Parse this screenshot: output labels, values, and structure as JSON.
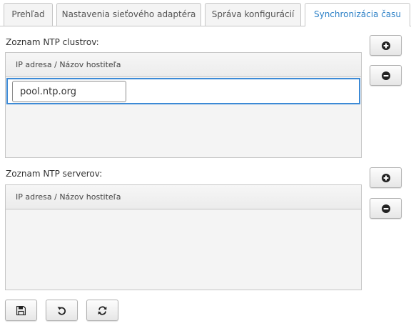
{
  "tabs": [
    {
      "label": "Prehľad"
    },
    {
      "label": "Nastavenia sieťového adaptéra"
    },
    {
      "label": "Správa konfigurácií"
    },
    {
      "label": "Synchronizácia času"
    }
  ],
  "clusters": {
    "label": "Zoznam NTP clustrov:",
    "column_header": "IP adresa / Názov hostiteľa",
    "editing_value": "pool.ntp.org"
  },
  "servers": {
    "label": "Zoznam NTP serverov:",
    "column_header": "IP adresa / Názov hostiteľa"
  },
  "icons": {
    "add": "plus-circle-icon",
    "remove": "minus-circle-icon",
    "save": "floppy-disk-icon",
    "revert": "undo-icon",
    "refresh": "refresh-icon"
  },
  "colors": {
    "active_tab_text": "#2a7fc6",
    "edit_border": "#3c8ad6",
    "grid_background": "#f4f4f4"
  }
}
